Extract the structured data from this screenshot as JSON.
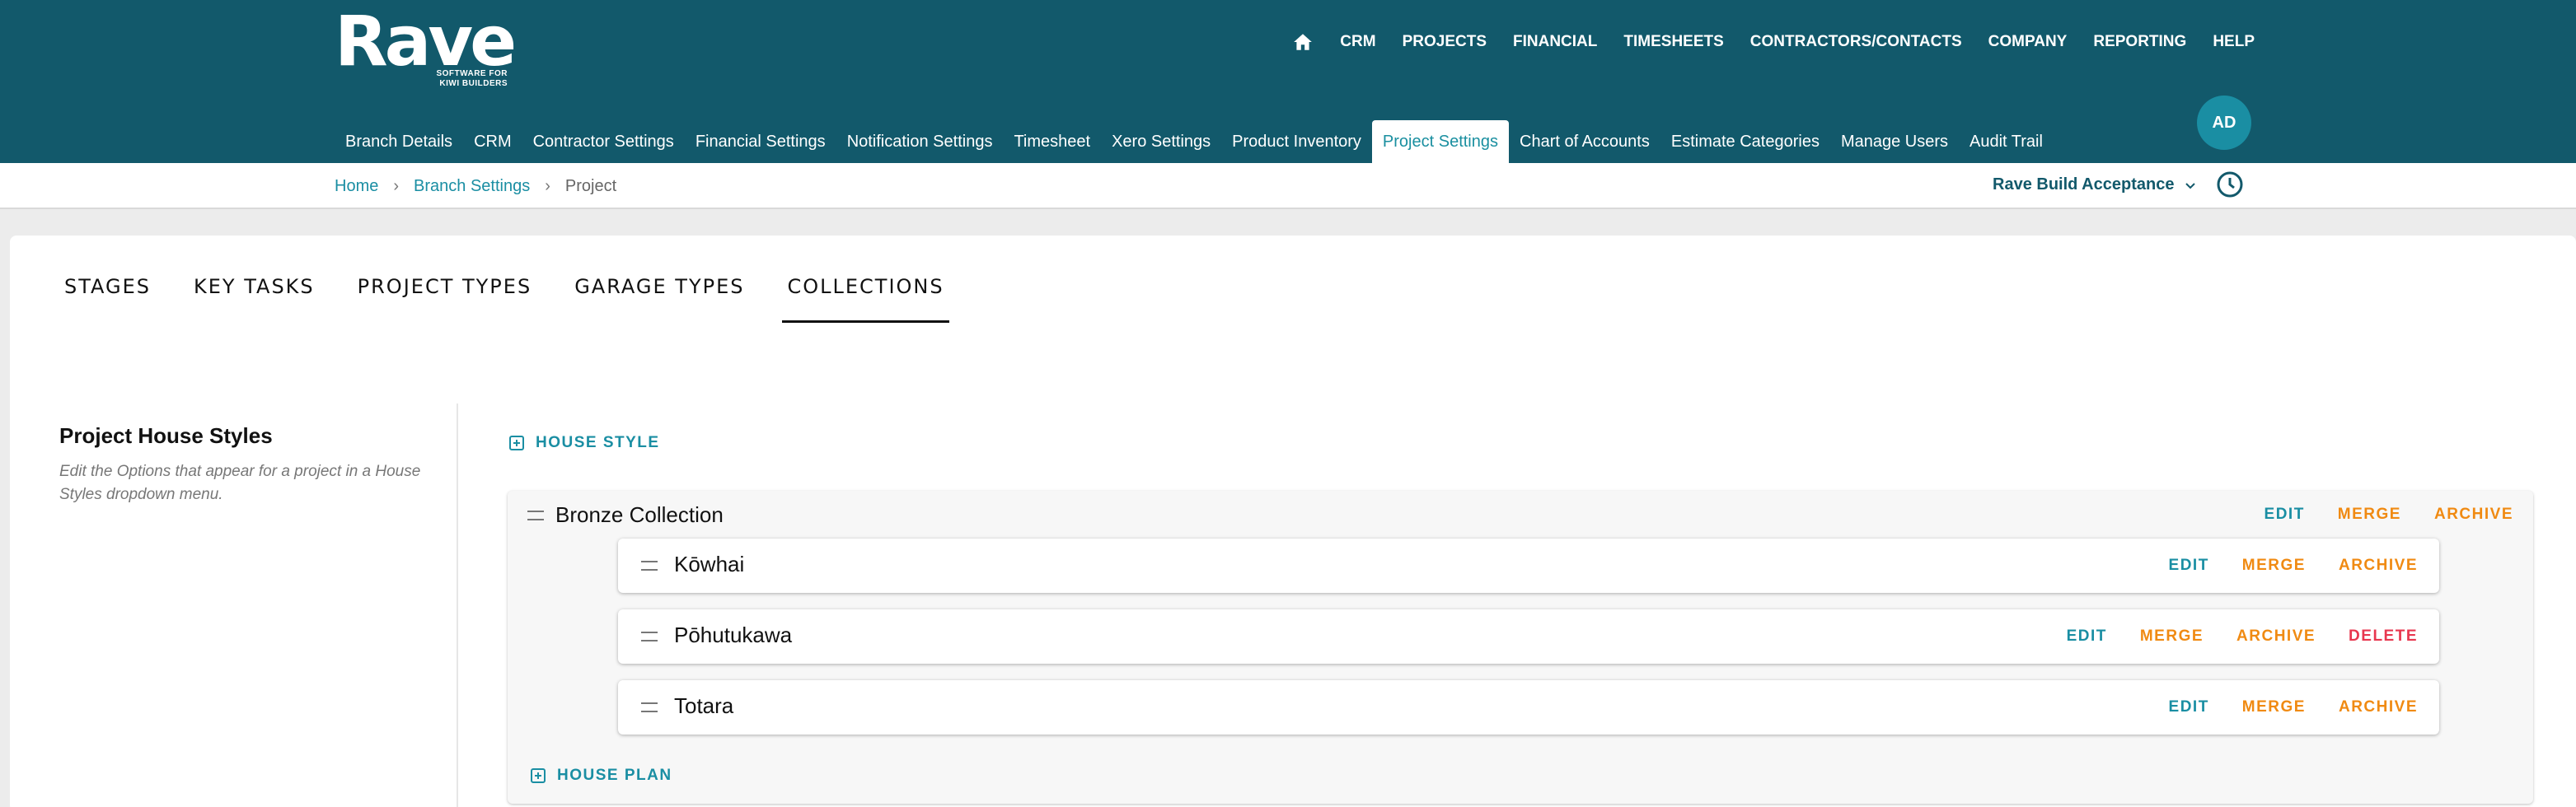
{
  "brand": {
    "name": "Rave",
    "tagline": "SOFTWARE FOR KIWI BUILDERS"
  },
  "main_nav": [
    "CRM",
    "PROJECTS",
    "FINANCIAL",
    "TIMESHEETS",
    "CONTRACTORS/CONTACTS",
    "COMPANY",
    "REPORTING",
    "HELP"
  ],
  "sub_nav": {
    "items": [
      "Branch Details",
      "CRM",
      "Contractor Settings",
      "Financial Settings",
      "Notification Settings",
      "Timesheet",
      "Xero Settings",
      "Product Inventory",
      "Project Settings",
      "Chart of Accounts",
      "Estimate Categories",
      "Manage Users",
      "Audit Trail"
    ],
    "active": "Project Settings"
  },
  "user": {
    "initials": "AD"
  },
  "breadcrumb": {
    "home": "Home",
    "branch_settings": "Branch Settings",
    "current": "Project"
  },
  "branch_selector": {
    "value": "Rave Build Acceptance"
  },
  "tabs": {
    "items": [
      "STAGES",
      "KEY TASKS",
      "PROJECT TYPES",
      "GARAGE TYPES",
      "COLLECTIONS"
    ],
    "active": "COLLECTIONS"
  },
  "section": {
    "title": "Project House Styles",
    "description": "Edit the Options that appear for a project in a House Styles dropdown menu."
  },
  "add_house_style_label": "HOUSE STYLE",
  "add_house_plan_label": "HOUSE PLAN",
  "action_labels": {
    "edit": "EDIT",
    "merge": "MERGE",
    "archive": "ARCHIVE",
    "delete": "DELETE"
  },
  "collection": {
    "name": "Bronze Collection",
    "items": [
      {
        "name": "Kōwhai",
        "can_delete": false
      },
      {
        "name": "Pōhutukawa",
        "can_delete": true
      },
      {
        "name": "Totara",
        "can_delete": false
      }
    ]
  },
  "colors": {
    "header_bg": "#12596b",
    "accent_teal": "#1a8ea3",
    "merge_orange": "#f08a12",
    "delete_red": "#e8374f"
  },
  "icons": [
    "home-icon",
    "chevron-down-icon",
    "clock-icon",
    "plus-square-icon",
    "drag-handle-icon"
  ]
}
